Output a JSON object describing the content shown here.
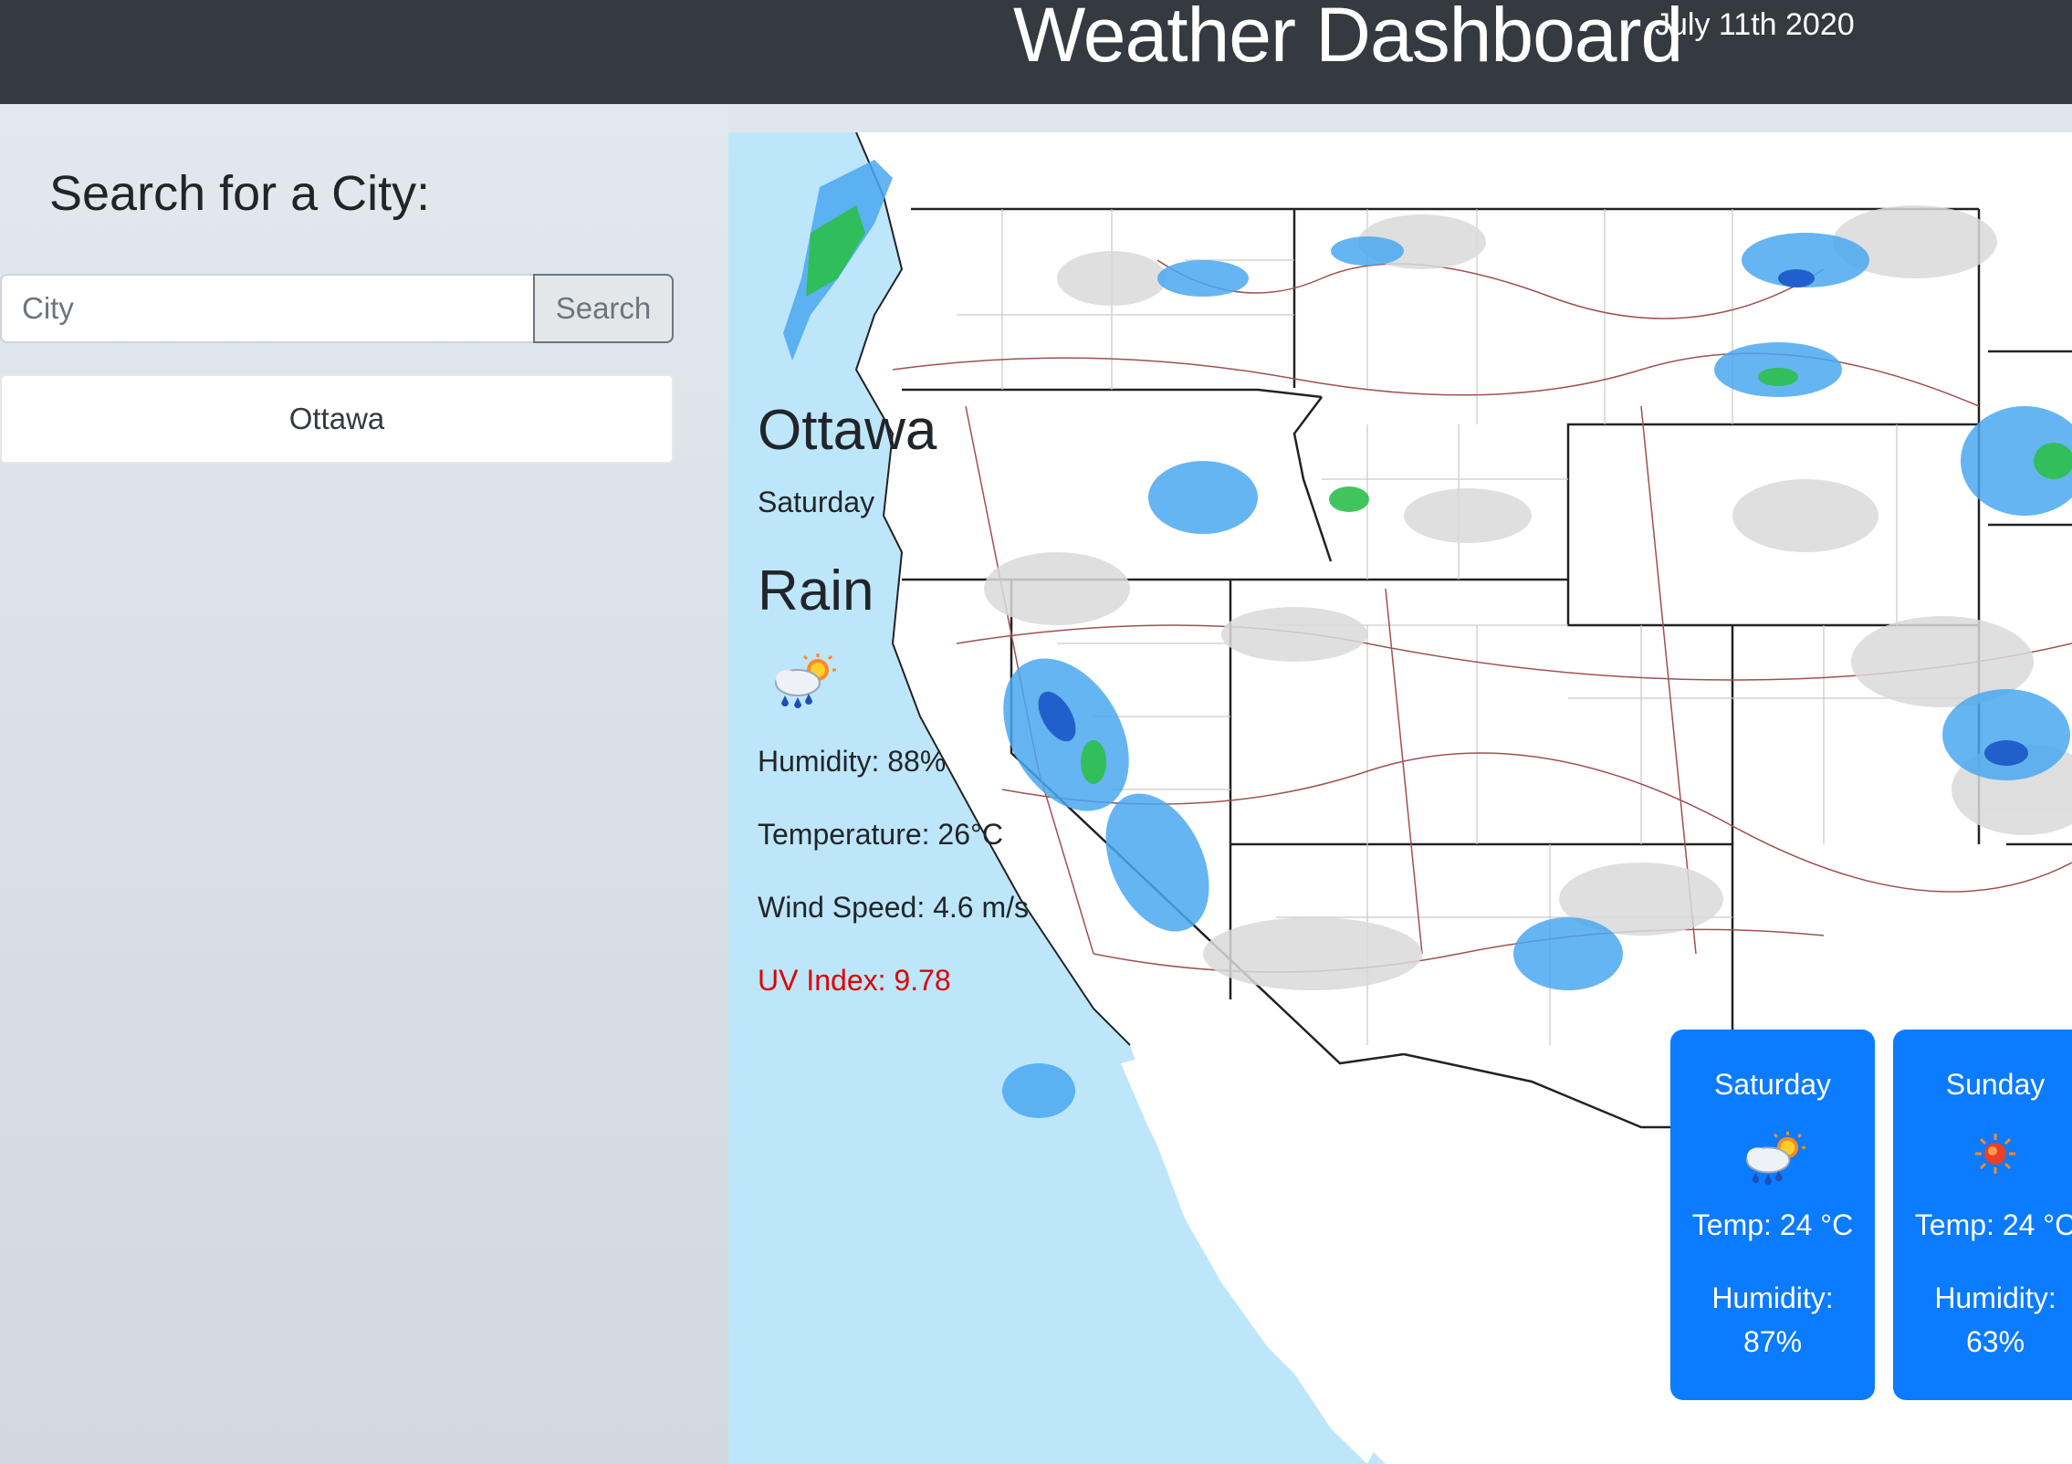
{
  "header": {
    "title": "Weather Dashboard",
    "date": "July 11th 2020"
  },
  "sidebar": {
    "heading": "Search for a City:",
    "search": {
      "placeholder": "City",
      "value": "",
      "button_label": "Search"
    },
    "history": [
      {
        "label": "Ottawa"
      }
    ]
  },
  "current": {
    "city": "Ottawa",
    "day": "Saturday",
    "condition": "Rain",
    "icon": "rain-sun-icon",
    "humidity": "Humidity: 88%",
    "temperature": "Temperature: 26°C",
    "wind": "Wind Speed: 4.6 m/s",
    "uv": "UV Index: 9.78",
    "uv_color": "#e00000"
  },
  "forecast": [
    {
      "day": "Saturday",
      "icon": "rain-sun-icon",
      "temp": "Temp: 24 °C",
      "humidity_label": "Humidity:",
      "humidity": "87%"
    },
    {
      "day": "Sunday",
      "icon": "sun-icon",
      "temp": "Temp: 24 °C",
      "humidity_label": "Humidity:",
      "humidity": "63%"
    }
  ],
  "map": {
    "type": "weather-radar",
    "ocean_color": "#bde6fa",
    "land_color": "#ffffff"
  },
  "colors": {
    "header_bg": "#343a40",
    "card_bg": "#0b7bff",
    "accent_red": "#e00000"
  }
}
